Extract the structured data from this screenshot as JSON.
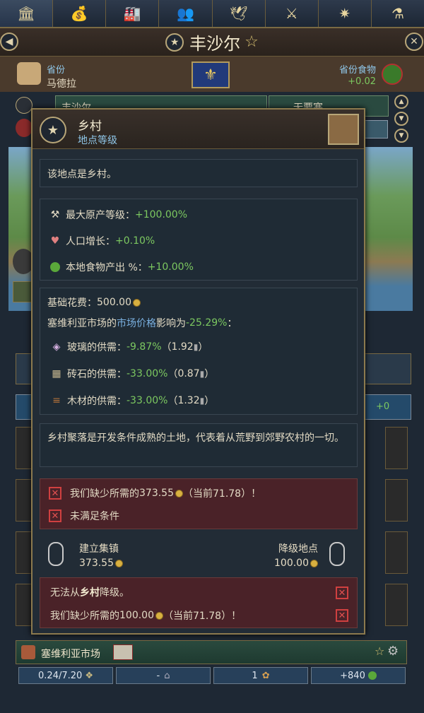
{
  "topbar": {
    "icons": [
      "government-icon",
      "economy-icon",
      "buildings-icon",
      "population-icon",
      "diplomacy-icon",
      "military-icon",
      "compass-icon",
      "science-flask-icon"
    ]
  },
  "title": {
    "name": "丰沙尔",
    "star": "☆"
  },
  "province": {
    "label": "省份",
    "name": "马德拉",
    "food_label": "省份食物",
    "food_value": "+0.02"
  },
  "behind": {
    "tab_left": "丰沙尔",
    "tab_right": "无要塞",
    "plus0": "+0"
  },
  "tooltip": {
    "title": "乡村",
    "subtitle": "地点等级",
    "intro": "该地点是乡村。",
    "modifiers": [
      {
        "icon": "tools-icon",
        "label": "最大原产等级：",
        "value": "+100.00%"
      },
      {
        "icon": "population-growth-icon",
        "label": "人口增长：",
        "value": "+0.10%"
      },
      {
        "icon": "apple-icon",
        "label": "本地食物产出 %：",
        "value": "+10.00%"
      }
    ],
    "base_cost_label": "基础花费：",
    "base_cost_value": "500.00",
    "market_prefix": "塞维利亚市场",
    "market_mid": "的",
    "market_link": "市场价格",
    "market_suffix": "影响为",
    "market_value": "-25.29%",
    "market_colon": "：",
    "supplies": [
      {
        "icon": "glass-icon",
        "name": "玻璃",
        "label": "的供需：",
        "value": "-9.87%",
        "open": "（",
        "amount": "1.92",
        "close": "）"
      },
      {
        "icon": "stone-icon",
        "name": "砖石",
        "label": "的供需：",
        "value": "-33.00%",
        "open": "（",
        "amount": "0.87",
        "close": "）"
      },
      {
        "icon": "lumber-icon",
        "name": "木材",
        "label": "的供需：",
        "value": "-33.00%",
        "open": "（",
        "amount": "1.32",
        "close": "）"
      }
    ],
    "description": "乡村聚落是开发条件成熟的土地，代表着从荒野到郊野农村的一切。",
    "req1_prefix": "我们缺少所需的",
    "req1_amount": "373.55",
    "req1_suffix": "（当前71.78）！",
    "req2": "未满足条件",
    "build_label": "建立集镇",
    "build_cost": "373.55",
    "downgrade_label": "降级地点",
    "downgrade_cost": "100.00",
    "err1_prefix": "无法从",
    "err1_bold": "乡村",
    "err1_suffix": "降级。",
    "err2_prefix": "我们缺少所需的",
    "err2_amount": "100.00",
    "err2_suffix": "（当前71.78）！"
  },
  "market_bar": {
    "name": "塞维利亚市场"
  },
  "stats": {
    "capacity": "0.24/7.20",
    "dash": "-",
    "count": "1",
    "food": "+840"
  },
  "colors": {
    "accent_gold": "#b8a678",
    "positive": "#7cc860",
    "negative": "#e07060",
    "link": "#7ab0e0",
    "error_bg": "#4a2228"
  }
}
